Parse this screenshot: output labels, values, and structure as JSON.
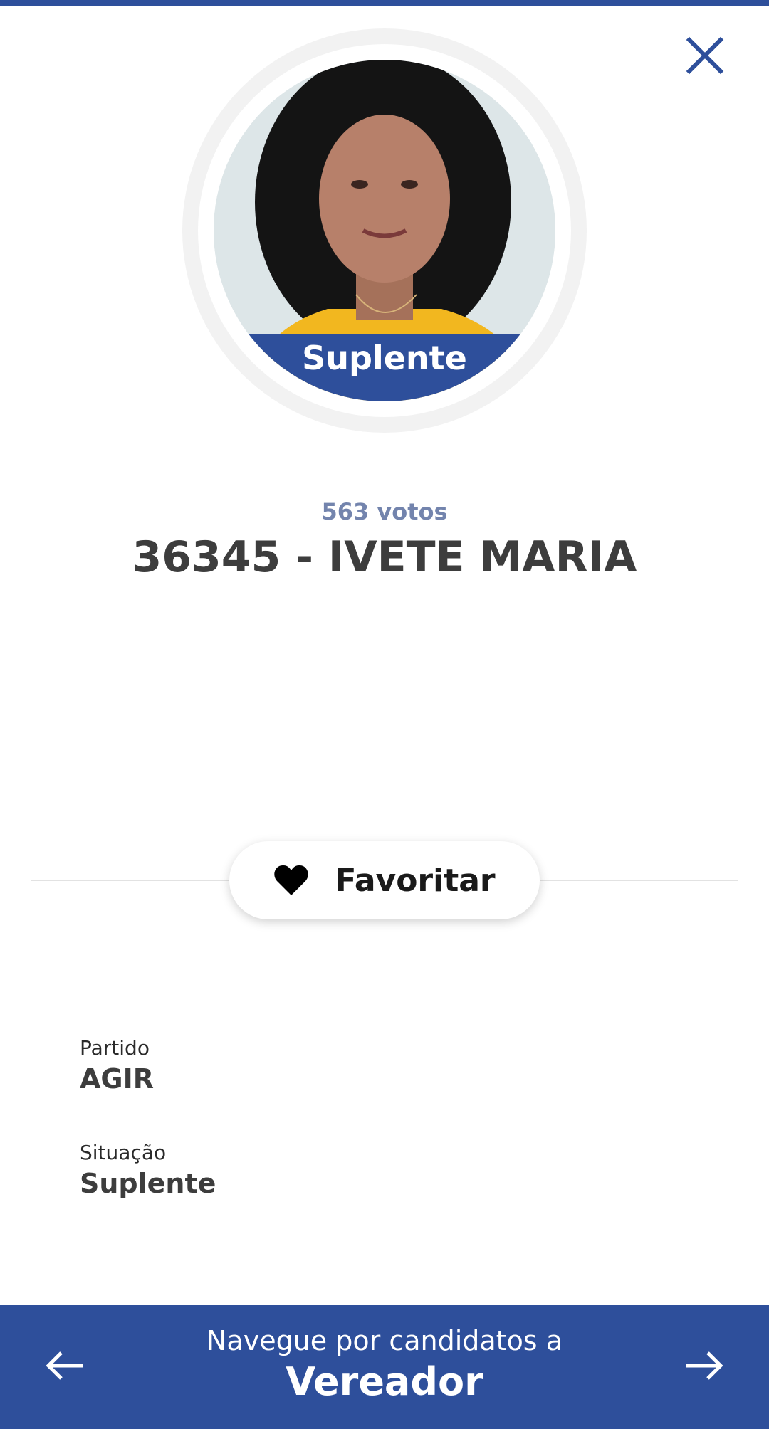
{
  "theme": {
    "accent": "#2e4f9b",
    "votes_color": "#7384ad",
    "text_color": "#3d3d3d"
  },
  "header": {
    "close_icon": "close-icon"
  },
  "candidate": {
    "status_badge": "Suplente",
    "votes": "563 votos",
    "name": "36345 - IVETE MARIA"
  },
  "actions": {
    "favorite_icon": "heart-icon",
    "favorite_label": "Favoritar"
  },
  "details": {
    "party_label": "Partido",
    "party_value": "AGIR",
    "situation_label": "Situação",
    "situation_value": "Suplente"
  },
  "navigation": {
    "prev_icon": "arrow-left-icon",
    "next_icon": "arrow-right-icon",
    "caption": "Navegue por candidatos a",
    "office": "Vereador"
  }
}
